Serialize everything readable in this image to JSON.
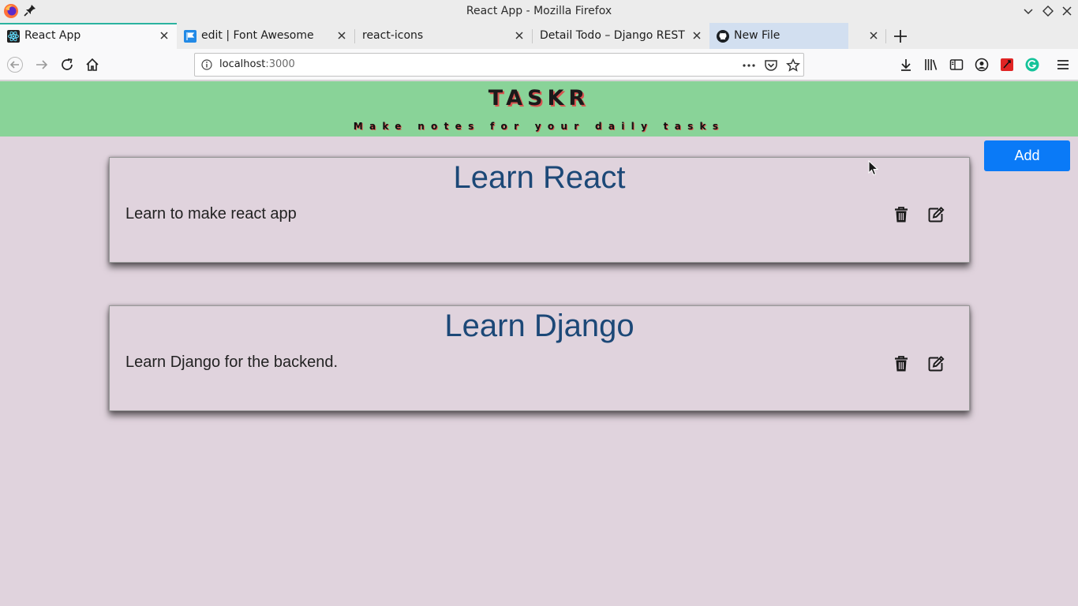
{
  "window": {
    "title": "React App - Mozilla Firefox"
  },
  "tabs": [
    {
      "label": "React App",
      "icon": "react-icon",
      "active": true
    },
    {
      "label": "edit | Font Awesome",
      "icon": "font-awesome-flag-icon"
    },
    {
      "label": "react-icons",
      "icon": ""
    },
    {
      "label": "Detail Todo – Django REST fram",
      "icon": ""
    },
    {
      "label": "New File",
      "icon": "github-icon"
    }
  ],
  "navbar": {
    "url_host": "localhost",
    "url_port": ":3000"
  },
  "app": {
    "title": "TASKR",
    "subtitle": "Make notes for your daily tasks",
    "add_label": "Add",
    "colors": {
      "header": "#89d398",
      "accent": "#0a7af7",
      "background": "#e0d3dd",
      "card_title": "#1c4877"
    }
  },
  "todos": [
    {
      "title": "Learn React",
      "description": "Learn to make react app"
    },
    {
      "title": "Learn Django",
      "description": "Learn Django for the backend."
    }
  ]
}
